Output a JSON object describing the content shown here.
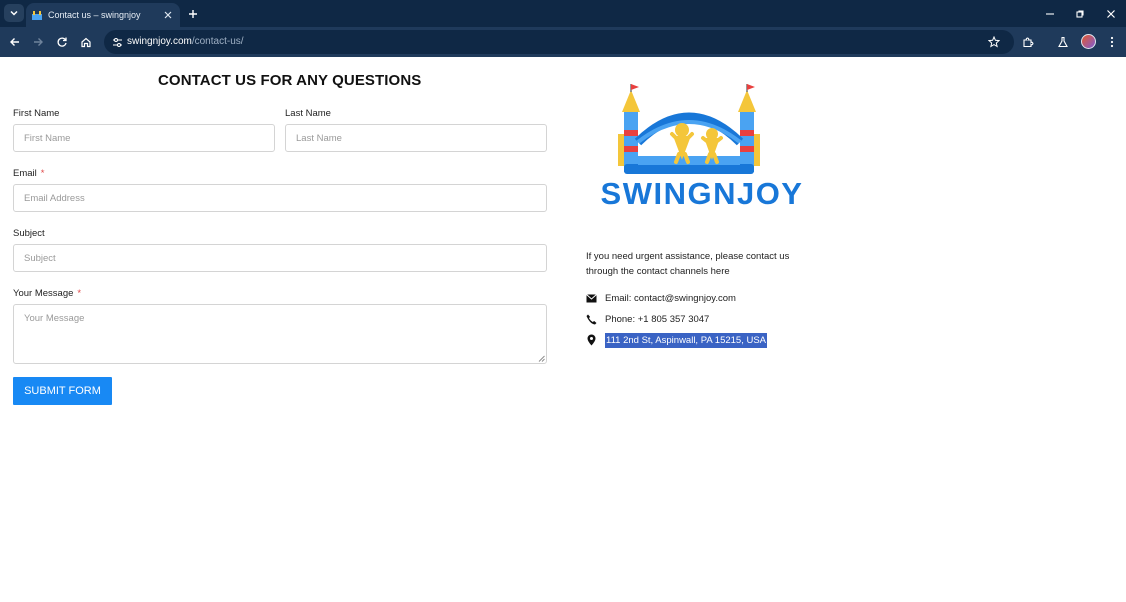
{
  "browser": {
    "tab_title": "Contact us – swingnjoy",
    "url_host": "swingnjoy.com",
    "url_path": "/contact-us/"
  },
  "page": {
    "title": "CONTACT US FOR ANY QUESTIONS",
    "form": {
      "first_name_label": "First Name",
      "first_name_placeholder": "First Name",
      "last_name_label": "Last Name",
      "last_name_placeholder": "Last Name",
      "email_label": "Email",
      "email_placeholder": "Email Address",
      "subject_label": "Subject",
      "subject_placeholder": "Subject",
      "message_label": "Your Message",
      "message_placeholder": "Your Message",
      "required_mark": "*",
      "submit_label": "SUBMIT FORM"
    },
    "logo_text": "SWINGNJOY",
    "intro": "If you need urgent assistance, please contact us through the contact channels here",
    "contacts": {
      "email": "Email: contact@swingnjoy.com",
      "phone": "Phone: +1 805 357 3047",
      "address": "111 2nd St, Aspinwall, PA 15215, USA"
    }
  },
  "colors": {
    "accent": "#1889f4",
    "logo_blue": "#1877d8",
    "chrome_dark": "#0f2845",
    "chrome_mid": "#1f3a5b",
    "selection": "#3a63c4"
  }
}
